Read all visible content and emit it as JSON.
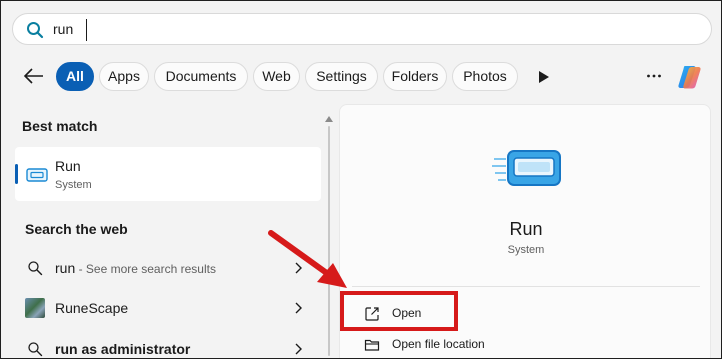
{
  "search": {
    "query": "run"
  },
  "filters": {
    "items": [
      {
        "label": "All",
        "active": true
      },
      {
        "label": "Apps"
      },
      {
        "label": "Documents"
      },
      {
        "label": "Web"
      },
      {
        "label": "Settings"
      },
      {
        "label": "Folders"
      },
      {
        "label": "Photos"
      }
    ],
    "more_icon": "play-triangle-icon",
    "overflow_icon": "ellipsis-icon",
    "assistant_icon": "copilot-icon"
  },
  "results": {
    "best_match_heading": "Best match",
    "best_match": {
      "title": "Run",
      "subtitle": "System",
      "icon": "run-app-icon"
    },
    "web_heading": "Search the web",
    "web_items": [
      {
        "query": "run",
        "hint": " - See more search results",
        "icon": "search-icon"
      },
      {
        "query": "RuneScape",
        "hint": "",
        "icon": "runescape-thumbnail"
      },
      {
        "query": "run as administrator",
        "hint": "",
        "icon": "search-icon"
      }
    ]
  },
  "preview": {
    "app_name": "Run",
    "app_type": "System",
    "actions": [
      {
        "label": "Open",
        "icon": "open-external-icon"
      },
      {
        "label": "Open file location",
        "icon": "folder-icon"
      }
    ]
  },
  "colors": {
    "accent": "#0a5fb4",
    "annotation": "#d61a1a"
  }
}
